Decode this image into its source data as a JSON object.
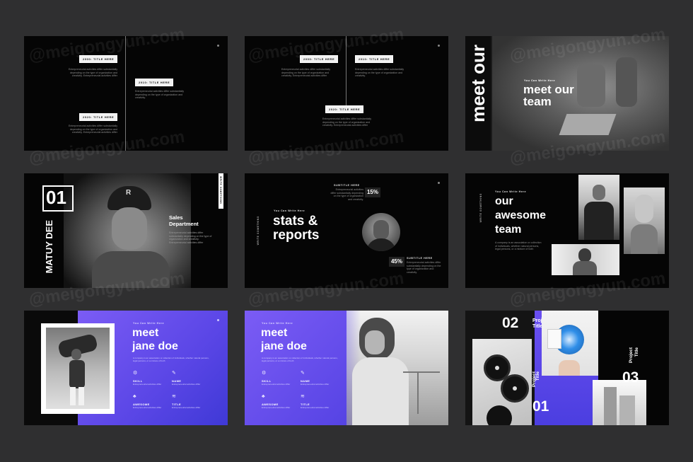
{
  "slide1": {
    "tags": [
      "2000: TITLE HERE",
      "2010: TITLE HERE",
      "2020: TITLE HERE"
    ],
    "desc": "Entrepreneurial activities differ substantially depending on the type of organization and creativity. Entrepreneurial activities differ",
    "desc_short": "Entrepreneurial activities differ substantially depending on the type of organization and creativity."
  },
  "slide2": {
    "tags": [
      "2000: TITLE HERE",
      "2010: TITLE HERE",
      "2020: TITLE HERE"
    ],
    "desc": "Entrepreneurial activities differ substantially depending on the type of organization and creativity. Entrepreneurial activities differ",
    "desc_short": "Entrepreneurial activities differ substantially depending on the type of organization and creativity."
  },
  "slide3": {
    "vertical": "meet our",
    "kicker": "You Can Write Here",
    "title_l1": "meet our",
    "title_l2": "team"
  },
  "slide4": {
    "number": "01",
    "name": "MATUY DEE",
    "dept_l1": "Sales",
    "dept_l2": "Department",
    "desc": "Entrepreneurial activities differ substantially depending on the type of organization and creativity. Entrepreneurial activities differ",
    "side": "WRITE SOMETHING"
  },
  "slide5": {
    "side": "WRITE SOMETHING",
    "kicker": "You Can Write Here",
    "title_l1": "stats &",
    "title_l2": "reports",
    "sub1": "SUBTITLE HERE",
    "sub2": "SUBTITLE HERE",
    "pct1": "15%",
    "pct2": "45%",
    "desc": "Entrepreneurial activities differ substantially depending on the type of organization and creativity."
  },
  "slide6": {
    "side": "WRITE SOMETHING",
    "kicker": "You Can Write Here",
    "title_l1": "our",
    "title_l2": "awesome",
    "title_l3": "team",
    "desc": "A company is an association or collection of individuals, whether natural persons, legal persons, or a mixture of both"
  },
  "slide7": {
    "kicker": "You Can Write Here",
    "title_l1": "meet",
    "title_l2": "jane doe",
    "desc": "A company is an association or collection of individuals, whether natural persons, legal persons, or a mixture of both",
    "items": [
      {
        "label": "SKILL",
        "sub": "Entrepreneurial activities differ"
      },
      {
        "label": "NAME",
        "sub": "Entrepreneurial activities differ"
      },
      {
        "label": "AWESOME",
        "sub": "Entrepreneurial activities differ"
      },
      {
        "label": "TITLE",
        "sub": "Entrepreneurial activities differ"
      }
    ]
  },
  "slide8": {
    "kicker": "You Can Write Here",
    "title_l1": "meet",
    "title_l2": "jane doe",
    "desc": "A company is an association or collection of individuals, whether natural persons, legal persons, or a mixture of both",
    "items": [
      {
        "label": "SKILL",
        "sub": "Entrepreneurial activities differ"
      },
      {
        "label": "NAME",
        "sub": "Entrepreneurial activities differ"
      },
      {
        "label": "AWESOME",
        "sub": "Entrepreneurial activities differ"
      },
      {
        "label": "TITLE",
        "sub": "Entrepreneurial activities differ"
      }
    ]
  },
  "slide9": {
    "n2": "02",
    "n3": "03",
    "n1": "01",
    "p_top": "Project",
    "t_top": "Title",
    "p_vert": "Project",
    "t_vert": "Title",
    "p_vert2": "Project",
    "t_vert2": "Title"
  },
  "watermark": "@meigongyun.com"
}
